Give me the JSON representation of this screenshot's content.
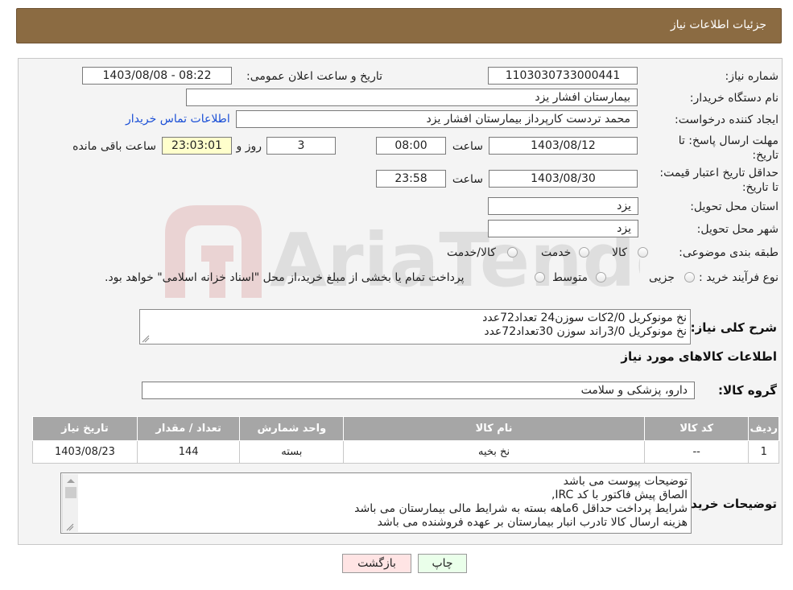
{
  "header": {
    "title": "جزئیات اطلاعات نیاز"
  },
  "form": {
    "need_number_label": "شماره نیاز:",
    "need_number": "1103030733000441",
    "announce_label": "تاریخ و ساعت اعلان عمومی:",
    "announce_value": "1403/08/08 - 08:22",
    "buyer_org_label": "نام دستگاه خریدار:",
    "buyer_org": "بیمارستان افشار یزد",
    "creator_label": "ایجاد کننده درخواست:",
    "creator": "محمد تردست کارپرداز بیمارستان افشار یزد",
    "contact_link": "اطلاعات تماس خریدار",
    "deadline_label": "مهلت ارسال پاسخ: تا تاریخ:",
    "deadline_date": "1403/08/12",
    "time_label": "ساعت",
    "deadline_time": "08:00",
    "days_value": "3",
    "days_label": "روز و",
    "remaining_value": "23:03:01",
    "remaining_label": "ساعت باقی مانده",
    "validity_label": "حداقل تاریخ اعتبار قیمت: تا تاریخ:",
    "validity_date": "1403/08/30",
    "validity_time": "23:58",
    "province_label": "استان محل تحویل:",
    "province": "یزد",
    "city_label": "شهر محل تحویل:",
    "city": "یزد",
    "category_label": "طبقه بندی موضوعی:",
    "category_options": [
      "کالا",
      "خدمت",
      "کالا/خدمت"
    ],
    "process_label": "نوع فرآیند خرید :",
    "process_options": [
      "جزیی",
      "متوسط"
    ],
    "process_note": "پرداخت تمام یا بخشی از مبلغ خرید،از محل \"اسناد خزانه اسلامی\" خواهد بود."
  },
  "description": {
    "label": "شرح کلی نیاز:",
    "lines": [
      "نخ مونوکریل 2/0کات سوزن24 تعداد72عدد",
      "نخ مونوکریل 3/0راند سوزن 30تعداد72عدد"
    ]
  },
  "goods_section_title": "اطلاعات کالاهای مورد نیاز",
  "goods_group": {
    "label": "گروه کالا:",
    "value": "دارو، پزشکی و سلامت"
  },
  "table": {
    "headers": [
      "ردیف",
      "کد کالا",
      "نام کالا",
      "واحد شمارش",
      "تعداد / مقدار",
      "تاریخ نیاز"
    ],
    "rows": [
      [
        "1",
        "--",
        "نخ بخیه",
        "بسته",
        "144",
        "1403/08/23"
      ]
    ]
  },
  "buyer_notes": {
    "label": "توضیحات خریدار:",
    "lines": [
      "توضیحات پیوست می باشد",
      "الصاق پیش فاکتور با کد  IRC,",
      "شرایط پرداخت    حداقل 6ماهه بسته به شرایط مالی بیمارستان می باشد",
      "هزینه ارسال کالا تادرب انبار بیمارستان بر عهده فروشنده می باشد"
    ]
  },
  "buttons": {
    "print": "چاپ",
    "back": "بازگشت"
  },
  "watermark": {
    "text": "AriaTender.neT"
  },
  "colors": {
    "header": "#8b6b42",
    "table_header": "#a6a6a6",
    "back_button": "#ffe4e4",
    "print_button": "#eaffea",
    "link": "#1a4fd6"
  }
}
